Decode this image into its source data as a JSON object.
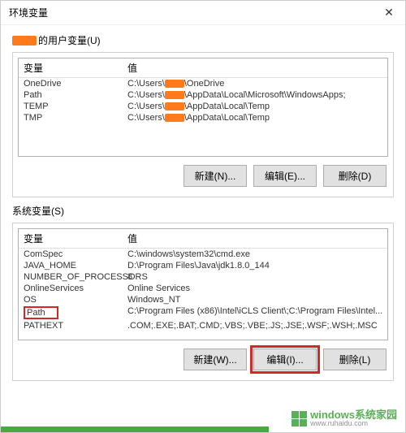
{
  "window": {
    "title": "环境变量"
  },
  "user_section": {
    "label_suffix": " 的用户变量(U)",
    "headers": {
      "name": "变量",
      "value": "值"
    },
    "rows": [
      {
        "name": "OneDrive",
        "prefix": "C:\\Users\\",
        "suffix": "\\OneDrive"
      },
      {
        "name": "Path",
        "prefix": "C:\\Users\\",
        "suffix": "\\AppData\\Local\\Microsoft\\WindowsApps;"
      },
      {
        "name": "TEMP",
        "prefix": "C:\\Users\\",
        "suffix": "\\AppData\\Local\\Temp"
      },
      {
        "name": "TMP",
        "prefix": "C:\\Users\\",
        "suffix": "\\AppData\\Local\\Temp"
      }
    ],
    "buttons": {
      "new": "新建(N)...",
      "edit": "编辑(E)...",
      "delete": "删除(D)"
    }
  },
  "sys_section": {
    "label": "系统变量(S)",
    "headers": {
      "name": "变量",
      "value": "值"
    },
    "rows": [
      {
        "name": "ComSpec",
        "value": "C:\\windows\\system32\\cmd.exe"
      },
      {
        "name": "JAVA_HOME",
        "value": "D:\\Program Files\\Java\\jdk1.8.0_144"
      },
      {
        "name": "NUMBER_OF_PROCESSORS",
        "value": "8"
      },
      {
        "name": "OnlineServices",
        "value": "Online Services"
      },
      {
        "name": "OS",
        "value": "Windows_NT"
      },
      {
        "name": "Path",
        "value": "C:\\Program Files (x86)\\Intel\\iCLS Client\\;C:\\Program Files\\Intel..."
      },
      {
        "name": "PATHEXT",
        "value": ".COM;.EXE;.BAT;.CMD;.VBS;.VBE;.JS;.JSE;.WSF;.WSH;.MSC"
      }
    ],
    "buttons": {
      "new": "新建(W)...",
      "edit": "编辑(I)...",
      "delete": "删除(L)"
    }
  },
  "watermark": {
    "line1": "windows系统家园",
    "line2": "www.ruhaidu.com"
  }
}
